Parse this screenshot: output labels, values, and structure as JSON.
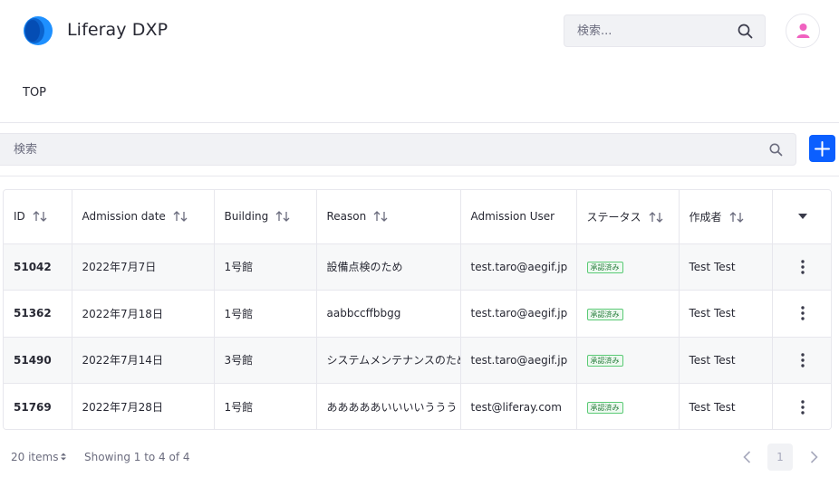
{
  "header": {
    "brand": "Liferay DXP",
    "search_placeholder": "検索...",
    "logo_colors": [
      "#0b63ce",
      "#1e90ff",
      "#003d9e"
    ]
  },
  "nav": {
    "items": [
      {
        "label": "TOP"
      }
    ]
  },
  "management": {
    "search_placeholder": "検索",
    "add_icon": "plus-icon",
    "accent": "#0b5fff"
  },
  "table": {
    "columns": [
      "ID",
      "Admission date",
      "Building",
      "Reason",
      "Admission User",
      "ステータス",
      "作成者"
    ],
    "rows": [
      {
        "id": "51042",
        "date": "2022年7月7日",
        "building": "1号館",
        "reason": "設備点検のため",
        "user": "test.taro@aegif.jp",
        "status": "承認済み",
        "creator": "Test Test"
      },
      {
        "id": "51362",
        "date": "2022年7月18日",
        "building": "1号館",
        "reason": "aabbccffbbgg",
        "user": "test.taro@aegif.jp",
        "status": "承認済み",
        "creator": "Test Test"
      },
      {
        "id": "51490",
        "date": "2022年7月14日",
        "building": "3号館",
        "reason": "システムメンテナンスのため",
        "user": "test.taro@aegif.jp",
        "status": "承認済み",
        "creator": "Test Test"
      },
      {
        "id": "51769",
        "date": "2022年7月28日",
        "building": "1号館",
        "reason": "あああああいいいいううう",
        "user": "test@liferay.com",
        "status": "承認済み",
        "creator": "Test Test"
      }
    ],
    "status_color": "#287d3c"
  },
  "pagination": {
    "items_label": "20 items",
    "showing": "Showing 1 to 4 of 4",
    "current_page": "1"
  }
}
